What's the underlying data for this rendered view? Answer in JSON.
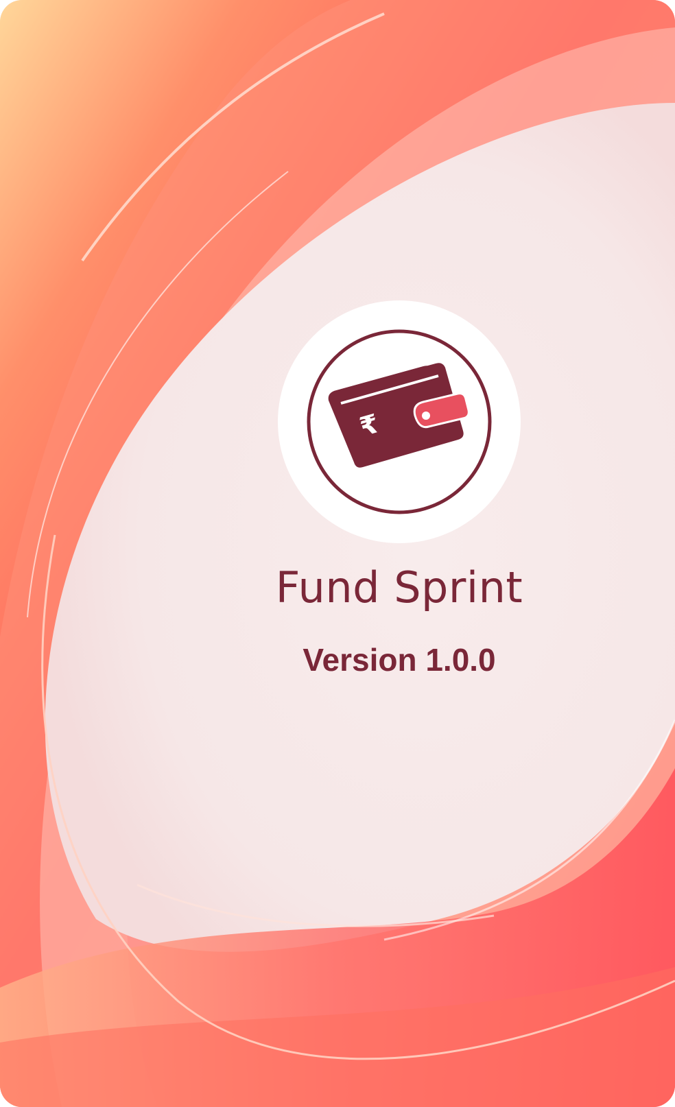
{
  "app": {
    "name": "Fund Sprint",
    "version": "Version 1.0.0"
  },
  "logo": {
    "icon": "wallet-rupee-icon",
    "currency_symbol": "₹"
  },
  "colors": {
    "brand_dark": "#7a2738",
    "accent_pink": "#e8505f",
    "background_tint": "#f6e9e9",
    "swirl_orange": "#ff7a4a",
    "swirl_red": "#ff4d4d"
  }
}
